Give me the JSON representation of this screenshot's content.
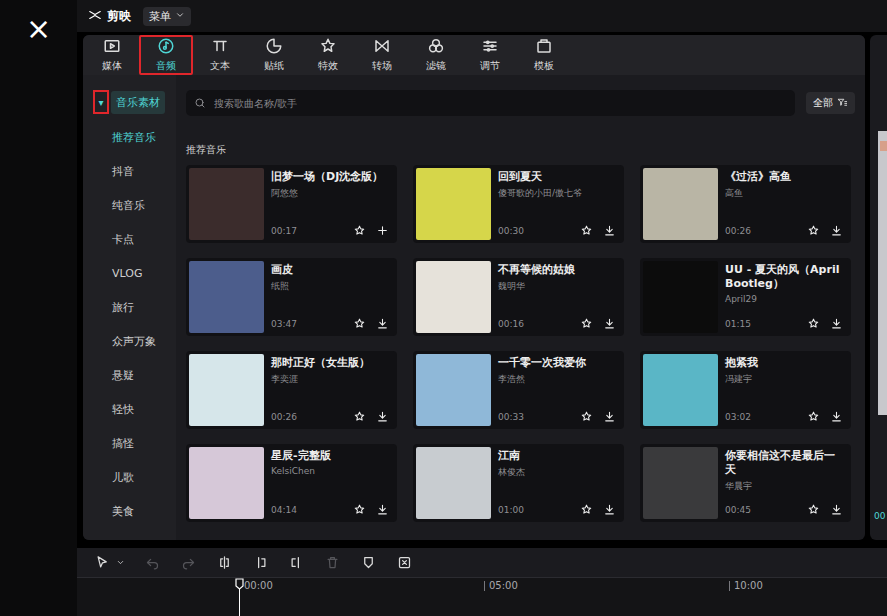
{
  "app": {
    "close": "×",
    "logo": "剪映",
    "menu": "菜单"
  },
  "tabs": [
    {
      "label": "媒体",
      "selected": false,
      "highlighted": false
    },
    {
      "label": "音频",
      "selected": true,
      "highlighted": true
    },
    {
      "label": "文本",
      "selected": false,
      "highlighted": false
    },
    {
      "label": "贴纸",
      "selected": false,
      "highlighted": false
    },
    {
      "label": "特效",
      "selected": false,
      "highlighted": false
    },
    {
      "label": "转场",
      "selected": false,
      "highlighted": false
    },
    {
      "label": "滤镜",
      "selected": false,
      "highlighted": false
    },
    {
      "label": "调节",
      "selected": false,
      "highlighted": false
    },
    {
      "label": "模板",
      "selected": false,
      "highlighted": false
    }
  ],
  "sidebar": {
    "header": {
      "caret": "▾",
      "label": "音乐素材",
      "expanded": true,
      "highlighted": true
    },
    "items": [
      {
        "label": "推荐音乐",
        "selected": true
      },
      {
        "label": "抖音",
        "selected": false
      },
      {
        "label": "纯音乐",
        "selected": false
      },
      {
        "label": "卡点",
        "selected": false
      },
      {
        "label": "VLOG",
        "selected": false
      },
      {
        "label": "旅行",
        "selected": false
      },
      {
        "label": "众声万象",
        "selected": false
      },
      {
        "label": "悬疑",
        "selected": false
      },
      {
        "label": "轻快",
        "selected": false
      },
      {
        "label": "搞怪",
        "selected": false
      },
      {
        "label": "儿歌",
        "selected": false
      },
      {
        "label": "美食",
        "selected": false
      }
    ]
  },
  "search": {
    "placeholder": "搜索歌曲名称/歌手",
    "filter": "全部"
  },
  "section_title": "推荐音乐",
  "songs": [
    {
      "title": "旧梦一场（DJ沈念版）",
      "artist": "阿悠悠",
      "duration": "00:17",
      "kind": "add",
      "color": "#3b2c2c"
    },
    {
      "title": "回到夏天",
      "artist": "傻哥歌的小田/傲七爷",
      "duration": "00:30",
      "kind": "download",
      "color": "#d6d64a"
    },
    {
      "title": "《过活》高鱼",
      "artist": "高鱼",
      "duration": "00:26",
      "kind": "download",
      "color": "#b9b5a5"
    },
    {
      "title": "画皮",
      "artist": "纸照",
      "duration": "03:47",
      "kind": "download",
      "color": "#4c5d8c"
    },
    {
      "title": "不再等候的姑娘",
      "artist": "魏明华",
      "duration": "00:16",
      "kind": "download",
      "color": "#e6e2da"
    },
    {
      "title": "UU - 夏天的风（April Bootleg）",
      "artist": "April29",
      "duration": "01:15",
      "kind": "download",
      "color": "#0c0c0c"
    },
    {
      "title": "那时正好（女生版）",
      "artist": "李奕涯",
      "duration": "00:26",
      "kind": "download",
      "color": "#d6e6ea"
    },
    {
      "title": "一千零一次我爱你",
      "artist": "李浩然",
      "duration": "00:33",
      "kind": "download",
      "color": "#8fb8d8"
    },
    {
      "title": "抱紧我",
      "artist": "冯建宇",
      "duration": "03:02",
      "kind": "download",
      "color": "#5ab6c6"
    },
    {
      "title": "星辰-完整版",
      "artist": "KelsiChen",
      "duration": "04:14",
      "kind": "download",
      "color": "#d6c8d8"
    },
    {
      "title": "江南",
      "artist": "林俊杰",
      "duration": "01:00",
      "kind": "download",
      "color": "#c8ccd0"
    },
    {
      "title": "你要相信这不是最后一天",
      "artist": "华晨宇",
      "duration": "00:45",
      "kind": "download",
      "color": "#3a3a3c"
    }
  ],
  "preview": {
    "time": "00"
  },
  "timeline": {
    "tools": [
      {
        "kind": "select",
        "disabled": false
      },
      {
        "kind": "undo",
        "disabled": true
      },
      {
        "kind": "redo",
        "disabled": true
      },
      {
        "kind": "split",
        "disabled": false
      },
      {
        "kind": "trimleft",
        "disabled": false
      },
      {
        "kind": "trimright",
        "disabled": false
      },
      {
        "kind": "delete",
        "disabled": true
      },
      {
        "kind": "marker",
        "disabled": false
      },
      {
        "kind": "crop",
        "disabled": false
      }
    ],
    "ruler": [
      "00:00",
      "05:00",
      "10:00"
    ]
  }
}
